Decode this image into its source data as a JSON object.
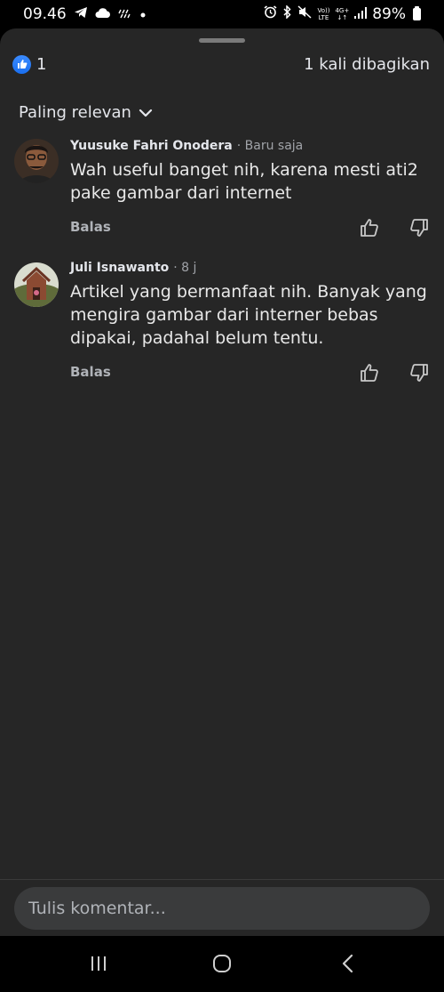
{
  "status_bar": {
    "time": "09.46",
    "battery": "89%",
    "network_top": "Vo))",
    "network_bottom": "LTE",
    "gen": "4G+"
  },
  "sheet": {
    "like_count": "1",
    "shares_text": "1 kali dibagikan",
    "sort_label": "Paling relevan"
  },
  "comments": [
    {
      "name": "Yuusuke Fahri Onodera",
      "time": "· Baru saja",
      "text": "Wah useful banget nih, karena mesti ati2 pake gambar dari internet",
      "reply_label": "Balas"
    },
    {
      "name": "Juli Isnawanto",
      "time": "· 8 j",
      "text": "Artikel yang bermanfaat nih. Banyak yang mengira gambar dari interner bebas dipakai, padahal belum tentu.",
      "reply_label": "Balas"
    }
  ],
  "input": {
    "placeholder": "Tulis komentar..."
  },
  "icons": {
    "like_badge": "thumbs-up-icon",
    "sort_toggle": "chevron-down-icon",
    "upvote": "thumbs-up-outline-icon",
    "downvote": "thumbs-down-outline-icon",
    "nav_recents": "recents-icon",
    "nav_home": "home-icon",
    "nav_back": "back-icon"
  },
  "colors": {
    "sheet_bg": "#262626",
    "accent_blue": "#1a6fef",
    "input_bg": "#3a3b3c"
  }
}
